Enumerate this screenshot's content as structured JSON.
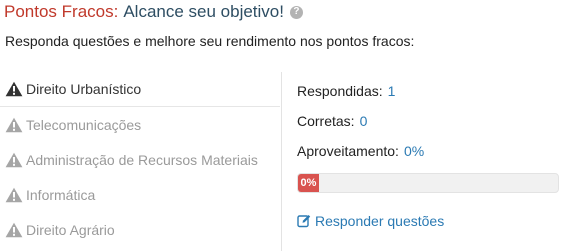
{
  "header": {
    "title_primary": "Pontos Fracos:",
    "title_secondary": "Alcance seu objetivo!",
    "help_icon": "question-circle-icon"
  },
  "subtitle": "Responda questões e melhore seu rendimento nos pontos fracos:",
  "topics": [
    {
      "label": "Direito Urbanístico",
      "icon": "warning-icon",
      "active": true
    },
    {
      "label": "Telecomunicações",
      "icon": "warning-icon",
      "active": false
    },
    {
      "label": "Administração de Recursos Materiais",
      "icon": "warning-icon",
      "active": false
    },
    {
      "label": "Informática",
      "icon": "warning-icon",
      "active": false
    },
    {
      "label": "Direito Agrário",
      "icon": "warning-icon",
      "active": false
    }
  ],
  "stats": {
    "answered_label": "Respondidas:",
    "answered_value": "1",
    "correct_label": "Corretas:",
    "correct_value": "0",
    "performance_label": "Aproveitamento:",
    "performance_value": "0%"
  },
  "progress": {
    "percent": 0,
    "label": "0%"
  },
  "action": {
    "label": "Responder questões",
    "icon": "edit-icon"
  },
  "colors": {
    "title_primary": "#c0392b",
    "title_secondary": "#2e4e63",
    "link": "#2b7ab3",
    "progress_bar": "#d9534f",
    "active_topic_text": "#333333",
    "inactive_topic_text": "#9a9a9a"
  }
}
